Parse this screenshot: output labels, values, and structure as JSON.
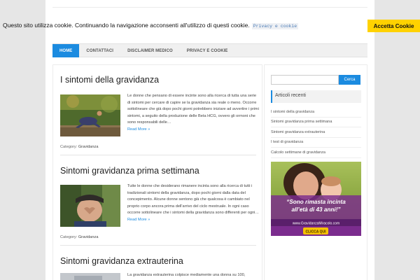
{
  "cookie": {
    "text": "Questo sito utilizza cookie. Continuando la navigazione acconsenti all'utilizzo di questi cookie.",
    "link": "Privacy e cookie",
    "accept": "Accetta Cookie"
  },
  "nav": {
    "items": [
      "HOME",
      "CONTATTACI",
      "DISCLAIMER MEDICO",
      "PRIVACY E COOKIE"
    ],
    "active": "HOME"
  },
  "posts": [
    {
      "title": "I sintomi della gravidanza",
      "excerpt": "Le donne che pensano di essere incinte sono alla ricerca di tutta una serie di sintomi per cercare di capire se la gravidanza sia reale o meno. Occorre sottolineare che già dopo pochi giorni potrebbero iniziare ad avvertire i primi sintomi, a seguito della produzione delle Beta HCG, ovvero gli ormoni che sono responsabili delle…",
      "readmore": "Read More »",
      "category_label": "Category:",
      "category": "Gravidanza"
    },
    {
      "title": "Sintomi gravidanza prima settimana",
      "excerpt": "Tutte le donne che desiderano rimanere incinta sono alla ricerca di tutti i tradizionali sintomi della gravidanza, dopo pochi giorni dalla data del concepimento. Alcune donne sentono già che qualcosa è cambiato nel proprio corpo ancora prima dell'arrivo del ciclo mestruale. In ogni caso occorre sottolineare che i sintomi della gravidanza sono differenti per ogni…",
      "readmore": "Read More »",
      "category_label": "Category:",
      "category": "Gravidanza"
    },
    {
      "title": "Sintomi gravidanza extrauterina",
      "excerpt": "La gravidanza extrauterina colpisce mediamente una donna su 100,"
    }
  ],
  "sidebar": {
    "search_button": "Cerca",
    "recent_title": "Articoli recenti",
    "recent": [
      "I sintomi della gravidanza",
      "Sintomi gravidanza prima settimana",
      "Sintomi gravidanza extrauterina",
      "I test di gravidanza",
      "Calcolo settimane di gravidanza"
    ],
    "ad": {
      "headline": "“Sono rimasta incinta all’età di 43 anni!”",
      "url": "www.GravidanzaMiracolo.com",
      "cta": "CLICCA QUI"
    }
  },
  "colors": {
    "accent": "#1b8be0",
    "cookie_button": "#ffd200"
  }
}
